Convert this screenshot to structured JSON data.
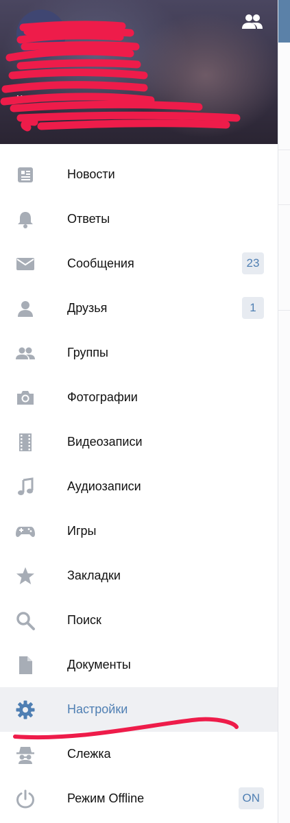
{
  "colors": {
    "accent": "#4f7fb3",
    "icon": "#a7adb6",
    "badge_bg": "#e7ebf1",
    "active_bg": "#eff0f3",
    "redaction": "#ee1c4a"
  },
  "header": {
    "name": "К",
    "status": "",
    "friends_icon": "people-icon"
  },
  "menu": {
    "items": [
      {
        "label": "Новости",
        "icon": "news-icon",
        "badge": ""
      },
      {
        "label": "Ответы",
        "icon": "bell-icon",
        "badge": ""
      },
      {
        "label": "Сообщения",
        "icon": "envelope-icon",
        "badge": "23"
      },
      {
        "label": "Друзья",
        "icon": "person-icon",
        "badge": "1"
      },
      {
        "label": "Группы",
        "icon": "people-icon",
        "badge": ""
      },
      {
        "label": "Фотографии",
        "icon": "camera-icon",
        "badge": ""
      },
      {
        "label": "Видеозаписи",
        "icon": "film-icon",
        "badge": ""
      },
      {
        "label": "Аудиозаписи",
        "icon": "music-note-icon",
        "badge": ""
      },
      {
        "label": "Игры",
        "icon": "gamepad-icon",
        "badge": ""
      },
      {
        "label": "Закладки",
        "icon": "star-icon",
        "badge": ""
      },
      {
        "label": "Поиск",
        "icon": "search-icon",
        "badge": ""
      },
      {
        "label": "Документы",
        "icon": "document-icon",
        "badge": ""
      },
      {
        "label": "Настройки",
        "icon": "gear-icon",
        "badge": "",
        "active": true
      },
      {
        "label": "Слежка",
        "icon": "spy-icon",
        "badge": ""
      },
      {
        "label": "Режим Offline",
        "icon": "power-icon",
        "badge": "ON"
      }
    ]
  }
}
